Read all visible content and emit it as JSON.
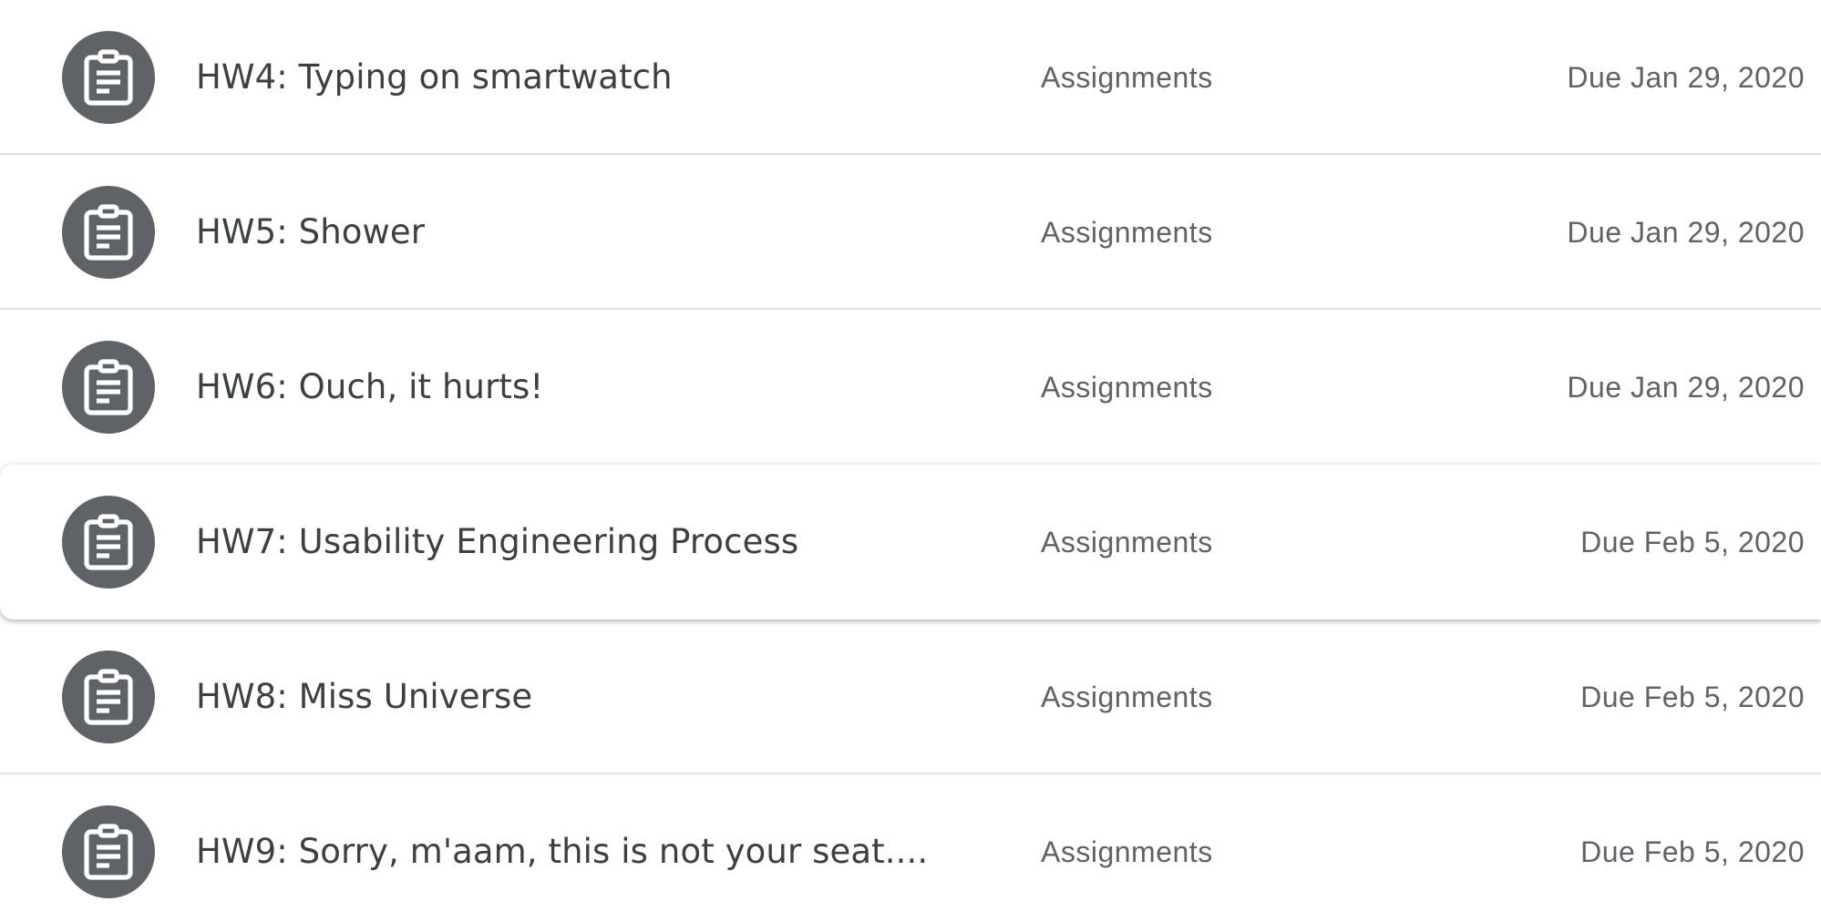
{
  "assignments": [
    {
      "title": "HW4: Typing on smartwatch",
      "topic": "Assignments",
      "due": "Due Jan 29, 2020",
      "icon": "assignment-icon"
    },
    {
      "title": "HW5: Shower",
      "topic": "Assignments",
      "due": "Due Jan 29, 2020",
      "icon": "assignment-icon"
    },
    {
      "title": "HW6: Ouch, it hurts!",
      "topic": "Assignments",
      "due": "Due Jan 29, 2020",
      "icon": "assignment-icon"
    },
    {
      "title": "HW7: Usability Engineering Process",
      "topic": "Assignments",
      "due": "Due Feb 5, 2020",
      "icon": "assignment-icon",
      "hovered": true
    },
    {
      "title": "HW8: Miss Universe",
      "topic": "Assignments",
      "due": "Due Feb 5, 2020",
      "icon": "assignment-icon"
    },
    {
      "title": "HW9: Sorry, m'aam, this is not your seat....",
      "topic": "Assignments",
      "due": "Due Feb 5, 2020",
      "icon": "assignment-icon"
    }
  ],
  "colors": {
    "icon_background": "#5f6368",
    "title_text": "#3c4043",
    "secondary_text": "#5f6368",
    "divider": "#e0e0e0"
  }
}
